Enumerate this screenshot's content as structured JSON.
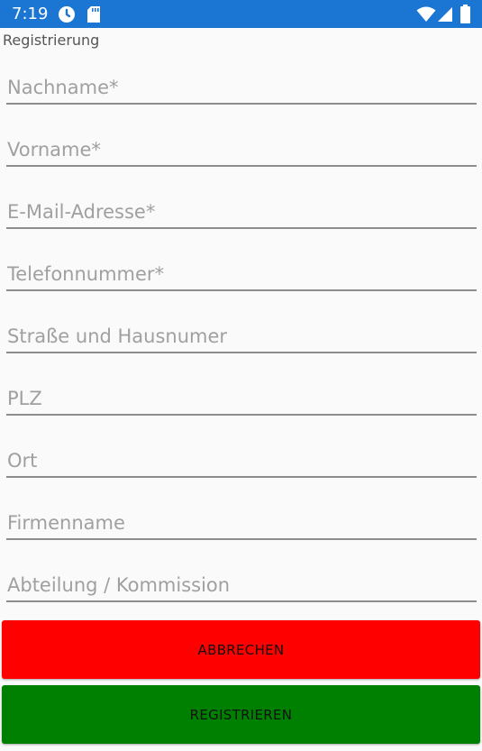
{
  "status_bar": {
    "time": "7:19",
    "background": "#1a76d2",
    "icons": [
      "alarm-icon",
      "sd-card-icon",
      "wifi-icon",
      "signal-icon",
      "battery-icon"
    ]
  },
  "screen": {
    "title": "Registrierung"
  },
  "form": {
    "fields": [
      {
        "placeholder": "Nachname*",
        "value": ""
      },
      {
        "placeholder": "Vorname*",
        "value": ""
      },
      {
        "placeholder": "E-Mail-Adresse*",
        "value": ""
      },
      {
        "placeholder": "Telefonnummer*",
        "value": ""
      },
      {
        "placeholder": "Straße und Hausnumer",
        "value": ""
      },
      {
        "placeholder": "PLZ",
        "value": ""
      },
      {
        "placeholder": "Ort",
        "value": ""
      },
      {
        "placeholder": "Firmenname",
        "value": ""
      },
      {
        "placeholder": "Abteilung / Kommission",
        "value": ""
      }
    ]
  },
  "buttons": {
    "cancel": {
      "label": "ABBRECHEN",
      "color": "#ff0000"
    },
    "register": {
      "label": "REGISTRIEREN",
      "color": "#008000"
    }
  }
}
